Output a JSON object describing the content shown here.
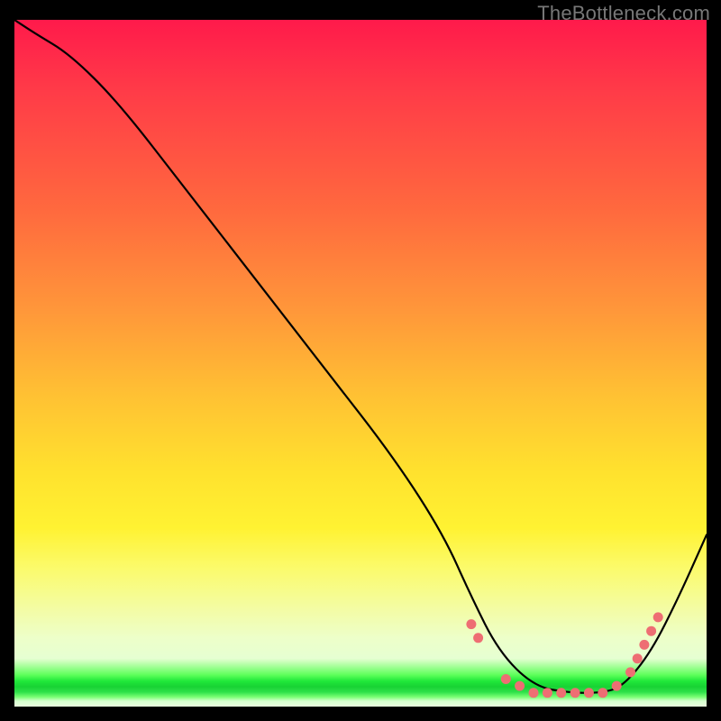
{
  "attribution": "TheBottleneck.com",
  "chart_data": {
    "type": "line",
    "title": "",
    "xlabel": "",
    "ylabel": "",
    "xlim": [
      0,
      100
    ],
    "ylim": [
      0,
      100
    ],
    "series": [
      {
        "name": "curve",
        "x": [
          0,
          3,
          8,
          15,
          25,
          35,
          45,
          55,
          62,
          66,
          70,
          75,
          80,
          85,
          88,
          92,
          96,
          100
        ],
        "y": [
          100,
          98,
          95,
          88,
          75,
          62,
          49,
          36,
          25,
          16,
          8,
          3,
          2,
          2,
          3,
          8,
          16,
          25
        ]
      }
    ],
    "markers": {
      "name": "dots",
      "color": "#ee6e73",
      "x": [
        66,
        67,
        71,
        73,
        75,
        77,
        79,
        81,
        83,
        85,
        87,
        89,
        90,
        91,
        92,
        93
      ],
      "y": [
        12,
        10,
        4,
        3,
        2,
        2,
        2,
        2,
        2,
        2,
        3,
        5,
        7,
        9,
        11,
        13
      ]
    }
  }
}
